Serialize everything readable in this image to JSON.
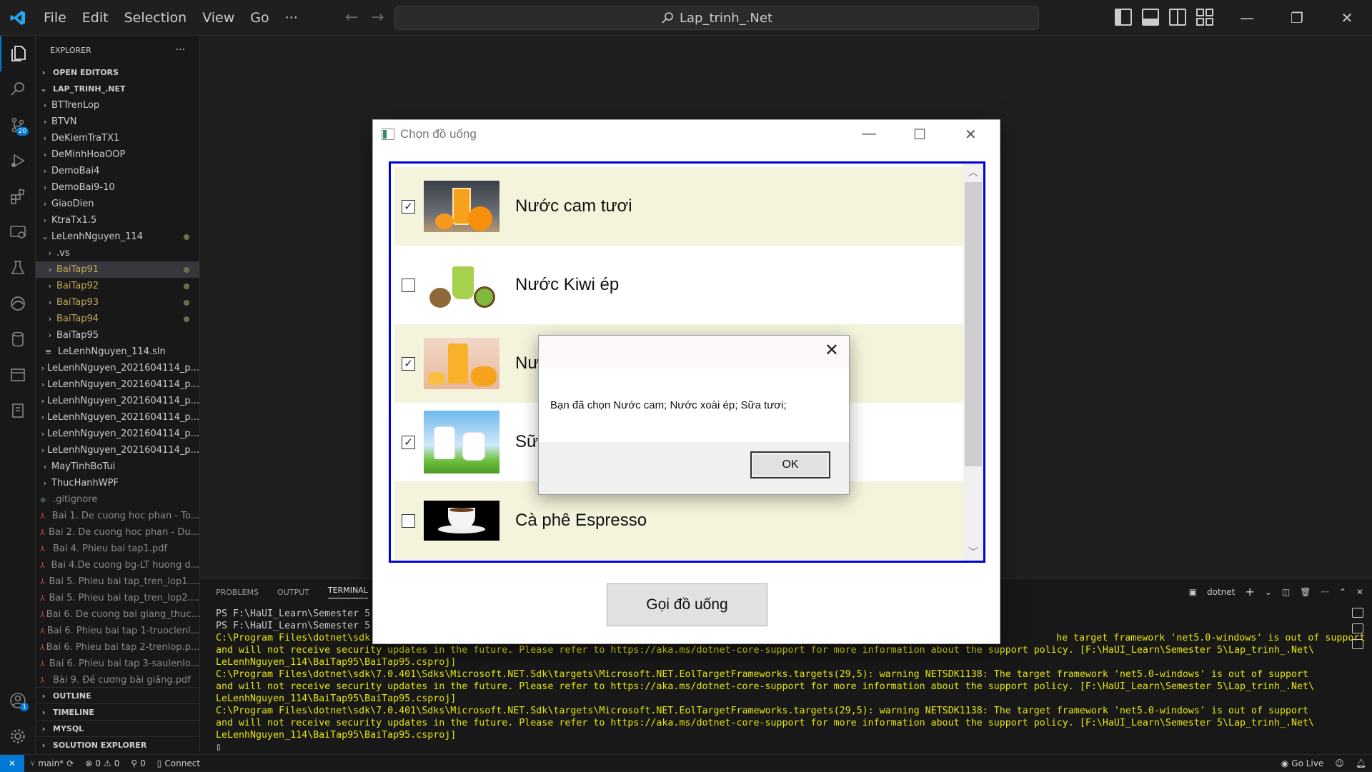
{
  "titlebar": {
    "menus": [
      "File",
      "Edit",
      "Selection",
      "View",
      "Go"
    ],
    "more": "···",
    "search": "Lap_trinh_.Net"
  },
  "activitybar": {
    "scm_badge": "20",
    "accounts_badge": "1"
  },
  "sidebar": {
    "title": "EXPLORER",
    "more": "···",
    "open_editors": "OPEN EDITORS",
    "workspace": "LAP_TRINH_.NET",
    "items": [
      {
        "label": "BTTrenLop",
        "indent": 1,
        "type": "folder"
      },
      {
        "label": "BTVN",
        "indent": 1,
        "type": "folder"
      },
      {
        "label": "DeKiemTraTX1",
        "indent": 1,
        "type": "folder"
      },
      {
        "label": "DeMinhHoaOOP",
        "indent": 1,
        "type": "folder"
      },
      {
        "label": "DemoBai4",
        "indent": 1,
        "type": "folder"
      },
      {
        "label": "DemoBai9-10",
        "indent": 1,
        "type": "folder"
      },
      {
        "label": "GiaoDien",
        "indent": 1,
        "type": "folder"
      },
      {
        "label": "KtraTx1.5",
        "indent": 1,
        "type": "folder"
      },
      {
        "label": "LeLenhNguyen_114",
        "indent": 1,
        "type": "folder-open",
        "modified": true
      },
      {
        "label": ".vs",
        "indent": 2,
        "type": "folder"
      },
      {
        "label": "BaiTap91",
        "indent": 2,
        "type": "folder",
        "modified": true,
        "selected": true
      },
      {
        "label": "BaiTap92",
        "indent": 2,
        "type": "folder",
        "modified": true
      },
      {
        "label": "BaiTap93",
        "indent": 2,
        "type": "folder",
        "modified": true
      },
      {
        "label": "BaiTap94",
        "indent": 2,
        "type": "folder",
        "modified": true
      },
      {
        "label": "BaiTap95",
        "indent": 2,
        "type": "folder"
      },
      {
        "label": "LeLenhNguyen_114.sln",
        "indent": 2,
        "type": "file-sln"
      },
      {
        "label": "LeLenhNguyen_2021604114_p...",
        "indent": 1,
        "type": "folder"
      },
      {
        "label": "LeLenhNguyen_2021604114_p...",
        "indent": 1,
        "type": "folder"
      },
      {
        "label": "LeLenhNguyen_2021604114_p...",
        "indent": 1,
        "type": "folder"
      },
      {
        "label": "LeLenhNguyen_2021604114_p...",
        "indent": 1,
        "type": "folder"
      },
      {
        "label": "LeLenhNguyen_2021604114_p...",
        "indent": 1,
        "type": "folder"
      },
      {
        "label": "LeLenhNguyen_2021604114_p...",
        "indent": 1,
        "type": "folder"
      },
      {
        "label": "MayTinhBoTui",
        "indent": 1,
        "type": "folder"
      },
      {
        "label": "ThucHanhWPF",
        "indent": 1,
        "type": "folder"
      },
      {
        "label": ".gitignore",
        "indent": 1,
        "type": "file-git"
      },
      {
        "label": "Bai 1. De cuong hoc phan - To...",
        "indent": 1,
        "type": "file-pdf"
      },
      {
        "label": "Bai 2. De cuong hoc phan - Du...",
        "indent": 1,
        "type": "file-pdf"
      },
      {
        "label": "Bai 4. Phieu bai tap1.pdf",
        "indent": 1,
        "type": "file-pdf"
      },
      {
        "label": "Bai 4.De cuong bg-LT huong d...",
        "indent": 1,
        "type": "file-pdf"
      },
      {
        "label": "Bai 5. Phieu bai tap_tren_lop1....",
        "indent": 1,
        "type": "file-pdf"
      },
      {
        "label": "Bai 5. Phieu bai tap_tren_lop2....",
        "indent": 1,
        "type": "file-pdf"
      },
      {
        "label": "Bai 6. De cuong bai giang_thuc...",
        "indent": 1,
        "type": "file-pdf"
      },
      {
        "label": "Bai 6. Phieu bai tap 1-truoclenl...",
        "indent": 1,
        "type": "file-pdf"
      },
      {
        "label": "Bai 6. Phieu bai tap 2-trenlop.p...",
        "indent": 1,
        "type": "file-pdf"
      },
      {
        "label": "Bai 6. Phieu bai tap 3-saulenlo...",
        "indent": 1,
        "type": "file-pdf"
      },
      {
        "label": "Bài 9. Đề cương bài giảng.pdf",
        "indent": 1,
        "type": "file-pdf"
      }
    ],
    "bottom_sections": [
      "OUTLINE",
      "TIMELINE",
      "MYSQL",
      "SOLUTION EXPLORER"
    ]
  },
  "panel": {
    "tabs": [
      "PROBLEMS",
      "OUTPUT",
      "TERMINAL"
    ],
    "active_tab": "TERMINAL",
    "shell": "dotnet",
    "lines_left": [
      "PS F:\\HaUI_Learn\\Semester 5",
      "PS F:\\HaUI_Learn\\Semester 5",
      "C:\\Program Files\\dotnet\\sdk"
    ],
    "line3_tail": "he target framework 'net5.0-windows' is out of support",
    "lines": [
      "and will not receive security updates in the future. Please refer to https://aka.ms/dotnet-core-support for more information about the support policy. [F:\\HaUI_Learn\\Semester 5\\Lap_trinh_.Net\\",
      "LeLenhNguyen_114\\BaiTap95\\BaiTap95.csproj]",
      "C:\\Program Files\\dotnet\\sdk\\7.0.401\\Sdks\\Microsoft.NET.Sdk\\targets\\Microsoft.NET.EolTargetFrameworks.targets(29,5): warning NETSDK1138: The target framework 'net5.0-windows' is out of support",
      "and will not receive security updates in the future. Please refer to https://aka.ms/dotnet-core-support for more information about the support policy. [F:\\HaUI_Learn\\Semester 5\\Lap_trinh_.Net\\",
      "LeLenhNguyen_114\\BaiTap95\\BaiTap95.csproj]",
      "C:\\Program Files\\dotnet\\sdk\\7.0.401\\Sdks\\Microsoft.NET.Sdk\\targets\\Microsoft.NET.EolTargetFrameworks.targets(29,5): warning NETSDK1138: The target framework 'net5.0-windows' is out of support",
      "and will not receive security updates in the future. Please refer to https://aka.ms/dotnet-core-support for more information about the support policy. [F:\\HaUI_Learn\\Semester 5\\Lap_trinh_.Net\\",
      "LeLenhNguyen_114\\BaiTap95\\BaiTap95.csproj]"
    ],
    "cursor": "▯"
  },
  "statusbar": {
    "branch": "main*",
    "errors": "0",
    "warnings": "0",
    "ports": "0",
    "connect": "Connect",
    "golive": "Go Live"
  },
  "wpf": {
    "title": "Chọn đồ uống",
    "items": [
      {
        "name": "Nước cam tươi",
        "checked": true,
        "image": "orange-juice"
      },
      {
        "name": "Nước Kiwi ép",
        "checked": false,
        "image": "kiwi-juice"
      },
      {
        "name": "Nước xoài ép",
        "checked": true,
        "image": "mango-juice"
      },
      {
        "name": "Sữa tươi",
        "checked": true,
        "image": "milk"
      },
      {
        "name": "Cà phê Espresso",
        "checked": false,
        "image": "espresso"
      }
    ],
    "order_button": "Gọi đồ uống"
  },
  "msgbox": {
    "message": "Bạn đã chọn Nước cam; Nước xoài ép;  Sữa tươi;",
    "ok": "OK"
  },
  "colors": {
    "accent": "#0078d4",
    "listbox_border": "#0000dd",
    "alt_row": "#f4f3dc"
  }
}
